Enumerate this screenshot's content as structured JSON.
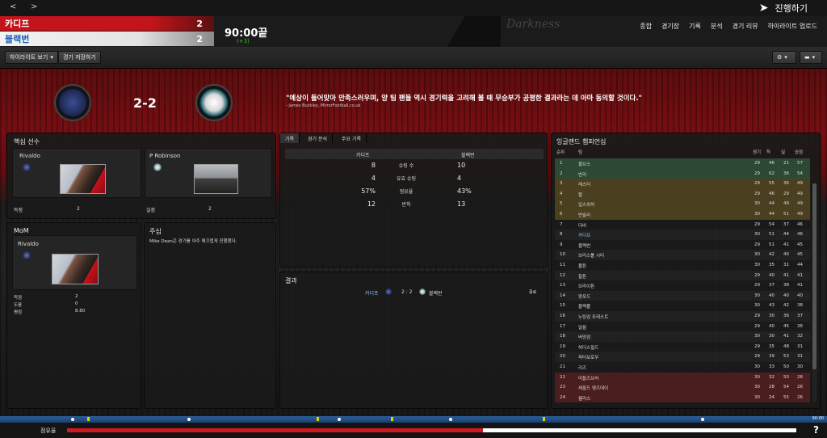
{
  "nav": {
    "back": "<",
    "forward": ">",
    "continue": "진행하기"
  },
  "match": {
    "home": "카디프",
    "away": "블랙번",
    "home_score": "2",
    "away_score": "2",
    "time": "90:00끝",
    "added": "(+3)",
    "big_score": "2-2",
    "watermark": "Darkness"
  },
  "tabs": [
    "종합",
    "경기장",
    "기록",
    "분석",
    "경기 리뷰",
    "하이라이트 업로드"
  ],
  "toolbar": {
    "highlights": "하이라이트 보기",
    "save": "경기 저장하기"
  },
  "quote": {
    "text": "\"예상이 들어맞아 만족스러우며, 양 팀 팬들 역시 경기력을 고려해 볼 때 무승부가 공평한 결과라는 데 아마 동의할 것이다.\"",
    "source": "- James Buckley, MirrorFootball.co.uk"
  },
  "key_players": {
    "title": "핵심 선수",
    "p1": {
      "name": "Rivaldo",
      "stat_label": "득점",
      "stat_value": "2"
    },
    "p2": {
      "name": "P Robinson",
      "stat_label": "실점",
      "stat_value": "2"
    }
  },
  "mom": {
    "title": "MoM",
    "name": "Rivaldo",
    "rows": [
      {
        "label": "득점",
        "value": "2"
      },
      {
        "label": "도움",
        "value": "0"
      },
      {
        "label": "평점",
        "value": "8.80"
      }
    ]
  },
  "referee": {
    "title": "주심",
    "text": "Mike Dean은 경기를 아주 매끄럽게 진행했다."
  },
  "stats": {
    "tabs": [
      "기록",
      "경기 분석",
      "주요 기록"
    ],
    "home": "카디프",
    "away": "블랙번",
    "rows": [
      {
        "h": "8",
        "label": "슈팅 수",
        "a": "10"
      },
      {
        "h": "4",
        "label": "유효 슈팅",
        "a": "4"
      },
      {
        "h": "57%",
        "label": "점유율",
        "a": "43%"
      },
      {
        "h": "12",
        "label": "반칙",
        "a": "13"
      }
    ]
  },
  "result": {
    "title": "결과",
    "home": "카디프",
    "score": "2 : 2",
    "away": "블랙번",
    "status": "종료"
  },
  "league": {
    "title": "잉글랜드 챔피언십",
    "headers": {
      "pos": "순위",
      "team": "팀",
      "p": "경기",
      "w": "득",
      "d": "실",
      "pts": "승점"
    },
    "rows": [
      {
        "pos": "1",
        "team": "울브스",
        "p": "29",
        "w": "46",
        "d": "21",
        "pts": "57"
      },
      {
        "pos": "2",
        "team": "번리",
        "p": "29",
        "w": "62",
        "d": "36",
        "pts": "54"
      },
      {
        "pos": "3",
        "team": "레스터",
        "p": "29",
        "w": "55",
        "d": "36",
        "pts": "49"
      },
      {
        "pos": "4",
        "team": "헐",
        "p": "29",
        "w": "46",
        "d": "29",
        "pts": "49"
      },
      {
        "pos": "5",
        "team": "입스위치",
        "p": "30",
        "w": "44",
        "d": "49",
        "pts": "49"
      },
      {
        "pos": "6",
        "team": "반슬리",
        "p": "30",
        "w": "44",
        "d": "51",
        "pts": "49"
      },
      {
        "pos": "7",
        "team": "더비",
        "p": "29",
        "w": "54",
        "d": "37",
        "pts": "46"
      },
      {
        "pos": "8",
        "team": "카디프",
        "p": "30",
        "w": "51",
        "d": "44",
        "pts": "46"
      },
      {
        "pos": "9",
        "team": "블랙번",
        "p": "29",
        "w": "51",
        "d": "41",
        "pts": "45"
      },
      {
        "pos": "10",
        "team": "브리스톨 시티",
        "p": "30",
        "w": "42",
        "d": "40",
        "pts": "45"
      },
      {
        "pos": "11",
        "team": "풀튼",
        "p": "30",
        "w": "35",
        "d": "31",
        "pts": "44"
      },
      {
        "pos": "12",
        "team": "찰튼",
        "p": "29",
        "w": "40",
        "d": "41",
        "pts": "41"
      },
      {
        "pos": "13",
        "team": "브라이튼",
        "p": "29",
        "w": "37",
        "d": "38",
        "pts": "41"
      },
      {
        "pos": "14",
        "team": "왓포드",
        "p": "30",
        "w": "40",
        "d": "40",
        "pts": "40"
      },
      {
        "pos": "15",
        "team": "블랙풀",
        "p": "30",
        "w": "43",
        "d": "42",
        "pts": "38"
      },
      {
        "pos": "16",
        "team": "노팅엄 포레스트",
        "p": "29",
        "w": "30",
        "d": "36",
        "pts": "37"
      },
      {
        "pos": "17",
        "team": "밀월",
        "p": "29",
        "w": "40",
        "d": "45",
        "pts": "36"
      },
      {
        "pos": "18",
        "team": "버밍엄",
        "p": "30",
        "w": "30",
        "d": "41",
        "pts": "32"
      },
      {
        "pos": "19",
        "team": "허더스필드",
        "p": "29",
        "w": "35",
        "d": "48",
        "pts": "31"
      },
      {
        "pos": "20",
        "team": "피터보로우",
        "p": "29",
        "w": "39",
        "d": "53",
        "pts": "31"
      },
      {
        "pos": "21",
        "team": "리즈",
        "p": "30",
        "w": "33",
        "d": "50",
        "pts": "30"
      },
      {
        "pos": "22",
        "team": "미들즈브러",
        "p": "30",
        "w": "32",
        "d": "50",
        "pts": "28"
      },
      {
        "pos": "23",
        "team": "셰필드 웬즈데이",
        "p": "30",
        "w": "28",
        "d": "54",
        "pts": "26"
      },
      {
        "pos": "24",
        "team": "웰리스",
        "p": "30",
        "w": "24",
        "d": "55",
        "pts": "26"
      }
    ]
  },
  "bottom": {
    "possession_label": "점유율",
    "possession_home": 0.57,
    "timeline_end": "90:00",
    "help": "?"
  },
  "colors": {
    "home": "#c4141b",
    "away_text": "#1b5fb8",
    "promotion": "#2c4a33",
    "playoff": "#4a3f1f",
    "relegation": "#4a1d1f",
    "added": "#3bbd3b"
  }
}
